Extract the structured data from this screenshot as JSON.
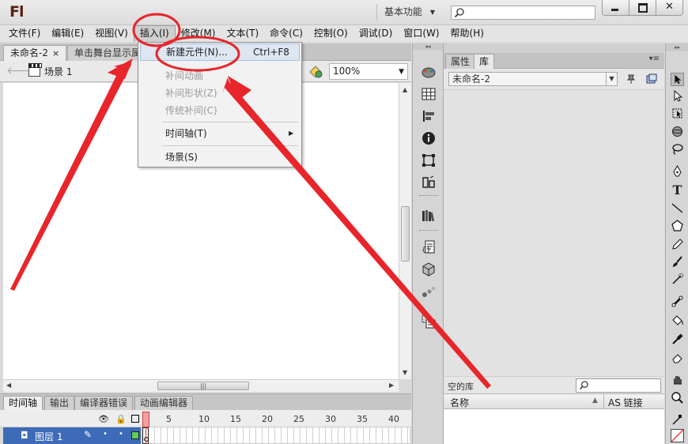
{
  "app": {
    "logo": "Fl",
    "workspace": "基本功能"
  },
  "menubar": [
    "文件(F)",
    "编辑(E)",
    "视图(V)",
    "插入(I)",
    "修改(M)",
    "文本(T)",
    "命令(C)",
    "控制(O)",
    "调试(D)",
    "窗口(W)",
    "帮助(H)"
  ],
  "doc_tabs": {
    "active": "未命名-2",
    "close": "×",
    "hint": "单击舞台显示属"
  },
  "editbar": {
    "scene": "场景 1",
    "zoom": "100%"
  },
  "insert_menu": {
    "new_symbol": "新建元件(N)...",
    "new_symbol_shortcut": "Ctrl+F8",
    "motion_tween": "补间动画",
    "shape_tween": "补间形状(Z)",
    "classic_tween": "传统补间(C)",
    "timeline": "时间轴(T)",
    "scene": "场景(S)"
  },
  "timeline": {
    "tabs": [
      "时间轴",
      "输出",
      "编译器错误",
      "动画编辑器"
    ],
    "ruler": [
      "1",
      "5",
      "10",
      "15",
      "20",
      "25",
      "30",
      "35",
      "40"
    ],
    "layer": "图层 1"
  },
  "panel": {
    "tabs": [
      "属性",
      "库"
    ],
    "library_doc": "未命名-2",
    "empty_label": "空的库",
    "col_name": "名称",
    "col_link": "AS 链接"
  },
  "colors": {
    "menu_highlight": "#dde6f1",
    "annotation": "#e8252a",
    "layer_selected": "#3e6bb8",
    "playhead": "#f39f9f"
  }
}
